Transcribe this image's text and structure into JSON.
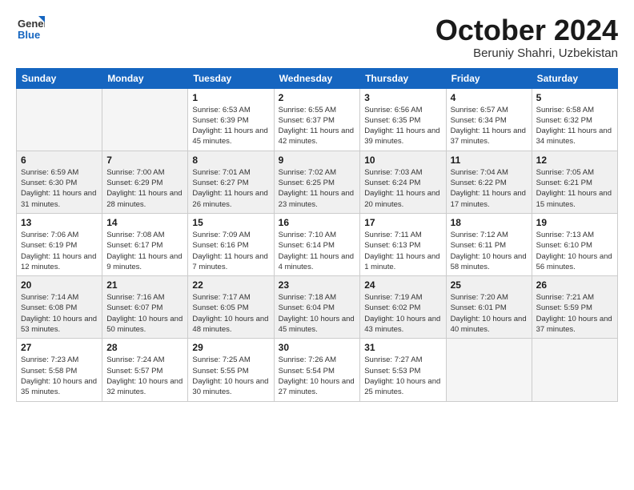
{
  "logo": {
    "general": "General",
    "blue": "Blue"
  },
  "title": "October 2024",
  "location": "Beruniy Shahri, Uzbekistan",
  "days_of_week": [
    "Sunday",
    "Monday",
    "Tuesday",
    "Wednesday",
    "Thursday",
    "Friday",
    "Saturday"
  ],
  "weeks": [
    [
      {
        "day": "",
        "sunrise": "",
        "sunset": "",
        "daylight": ""
      },
      {
        "day": "",
        "sunrise": "",
        "sunset": "",
        "daylight": ""
      },
      {
        "day": "1",
        "sunrise": "Sunrise: 6:53 AM",
        "sunset": "Sunset: 6:39 PM",
        "daylight": "Daylight: 11 hours and 45 minutes."
      },
      {
        "day": "2",
        "sunrise": "Sunrise: 6:55 AM",
        "sunset": "Sunset: 6:37 PM",
        "daylight": "Daylight: 11 hours and 42 minutes."
      },
      {
        "day": "3",
        "sunrise": "Sunrise: 6:56 AM",
        "sunset": "Sunset: 6:35 PM",
        "daylight": "Daylight: 11 hours and 39 minutes."
      },
      {
        "day": "4",
        "sunrise": "Sunrise: 6:57 AM",
        "sunset": "Sunset: 6:34 PM",
        "daylight": "Daylight: 11 hours and 37 minutes."
      },
      {
        "day": "5",
        "sunrise": "Sunrise: 6:58 AM",
        "sunset": "Sunset: 6:32 PM",
        "daylight": "Daylight: 11 hours and 34 minutes."
      }
    ],
    [
      {
        "day": "6",
        "sunrise": "Sunrise: 6:59 AM",
        "sunset": "Sunset: 6:30 PM",
        "daylight": "Daylight: 11 hours and 31 minutes."
      },
      {
        "day": "7",
        "sunrise": "Sunrise: 7:00 AM",
        "sunset": "Sunset: 6:29 PM",
        "daylight": "Daylight: 11 hours and 28 minutes."
      },
      {
        "day": "8",
        "sunrise": "Sunrise: 7:01 AM",
        "sunset": "Sunset: 6:27 PM",
        "daylight": "Daylight: 11 hours and 26 minutes."
      },
      {
        "day": "9",
        "sunrise": "Sunrise: 7:02 AM",
        "sunset": "Sunset: 6:25 PM",
        "daylight": "Daylight: 11 hours and 23 minutes."
      },
      {
        "day": "10",
        "sunrise": "Sunrise: 7:03 AM",
        "sunset": "Sunset: 6:24 PM",
        "daylight": "Daylight: 11 hours and 20 minutes."
      },
      {
        "day": "11",
        "sunrise": "Sunrise: 7:04 AM",
        "sunset": "Sunset: 6:22 PM",
        "daylight": "Daylight: 11 hours and 17 minutes."
      },
      {
        "day": "12",
        "sunrise": "Sunrise: 7:05 AM",
        "sunset": "Sunset: 6:21 PM",
        "daylight": "Daylight: 11 hours and 15 minutes."
      }
    ],
    [
      {
        "day": "13",
        "sunrise": "Sunrise: 7:06 AM",
        "sunset": "Sunset: 6:19 PM",
        "daylight": "Daylight: 11 hours and 12 minutes."
      },
      {
        "day": "14",
        "sunrise": "Sunrise: 7:08 AM",
        "sunset": "Sunset: 6:17 PM",
        "daylight": "Daylight: 11 hours and 9 minutes."
      },
      {
        "day": "15",
        "sunrise": "Sunrise: 7:09 AM",
        "sunset": "Sunset: 6:16 PM",
        "daylight": "Daylight: 11 hours and 7 minutes."
      },
      {
        "day": "16",
        "sunrise": "Sunrise: 7:10 AM",
        "sunset": "Sunset: 6:14 PM",
        "daylight": "Daylight: 11 hours and 4 minutes."
      },
      {
        "day": "17",
        "sunrise": "Sunrise: 7:11 AM",
        "sunset": "Sunset: 6:13 PM",
        "daylight": "Daylight: 11 hours and 1 minute."
      },
      {
        "day": "18",
        "sunrise": "Sunrise: 7:12 AM",
        "sunset": "Sunset: 6:11 PM",
        "daylight": "Daylight: 10 hours and 58 minutes."
      },
      {
        "day": "19",
        "sunrise": "Sunrise: 7:13 AM",
        "sunset": "Sunset: 6:10 PM",
        "daylight": "Daylight: 10 hours and 56 minutes."
      }
    ],
    [
      {
        "day": "20",
        "sunrise": "Sunrise: 7:14 AM",
        "sunset": "Sunset: 6:08 PM",
        "daylight": "Daylight: 10 hours and 53 minutes."
      },
      {
        "day": "21",
        "sunrise": "Sunrise: 7:16 AM",
        "sunset": "Sunset: 6:07 PM",
        "daylight": "Daylight: 10 hours and 50 minutes."
      },
      {
        "day": "22",
        "sunrise": "Sunrise: 7:17 AM",
        "sunset": "Sunset: 6:05 PM",
        "daylight": "Daylight: 10 hours and 48 minutes."
      },
      {
        "day": "23",
        "sunrise": "Sunrise: 7:18 AM",
        "sunset": "Sunset: 6:04 PM",
        "daylight": "Daylight: 10 hours and 45 minutes."
      },
      {
        "day": "24",
        "sunrise": "Sunrise: 7:19 AM",
        "sunset": "Sunset: 6:02 PM",
        "daylight": "Daylight: 10 hours and 43 minutes."
      },
      {
        "day": "25",
        "sunrise": "Sunrise: 7:20 AM",
        "sunset": "Sunset: 6:01 PM",
        "daylight": "Daylight: 10 hours and 40 minutes."
      },
      {
        "day": "26",
        "sunrise": "Sunrise: 7:21 AM",
        "sunset": "Sunset: 5:59 PM",
        "daylight": "Daylight: 10 hours and 37 minutes."
      }
    ],
    [
      {
        "day": "27",
        "sunrise": "Sunrise: 7:23 AM",
        "sunset": "Sunset: 5:58 PM",
        "daylight": "Daylight: 10 hours and 35 minutes."
      },
      {
        "day": "28",
        "sunrise": "Sunrise: 7:24 AM",
        "sunset": "Sunset: 5:57 PM",
        "daylight": "Daylight: 10 hours and 32 minutes."
      },
      {
        "day": "29",
        "sunrise": "Sunrise: 7:25 AM",
        "sunset": "Sunset: 5:55 PM",
        "daylight": "Daylight: 10 hours and 30 minutes."
      },
      {
        "day": "30",
        "sunrise": "Sunrise: 7:26 AM",
        "sunset": "Sunset: 5:54 PM",
        "daylight": "Daylight: 10 hours and 27 minutes."
      },
      {
        "day": "31",
        "sunrise": "Sunrise: 7:27 AM",
        "sunset": "Sunset: 5:53 PM",
        "daylight": "Daylight: 10 hours and 25 minutes."
      },
      {
        "day": "",
        "sunrise": "",
        "sunset": "",
        "daylight": ""
      },
      {
        "day": "",
        "sunrise": "",
        "sunset": "",
        "daylight": ""
      }
    ]
  ]
}
